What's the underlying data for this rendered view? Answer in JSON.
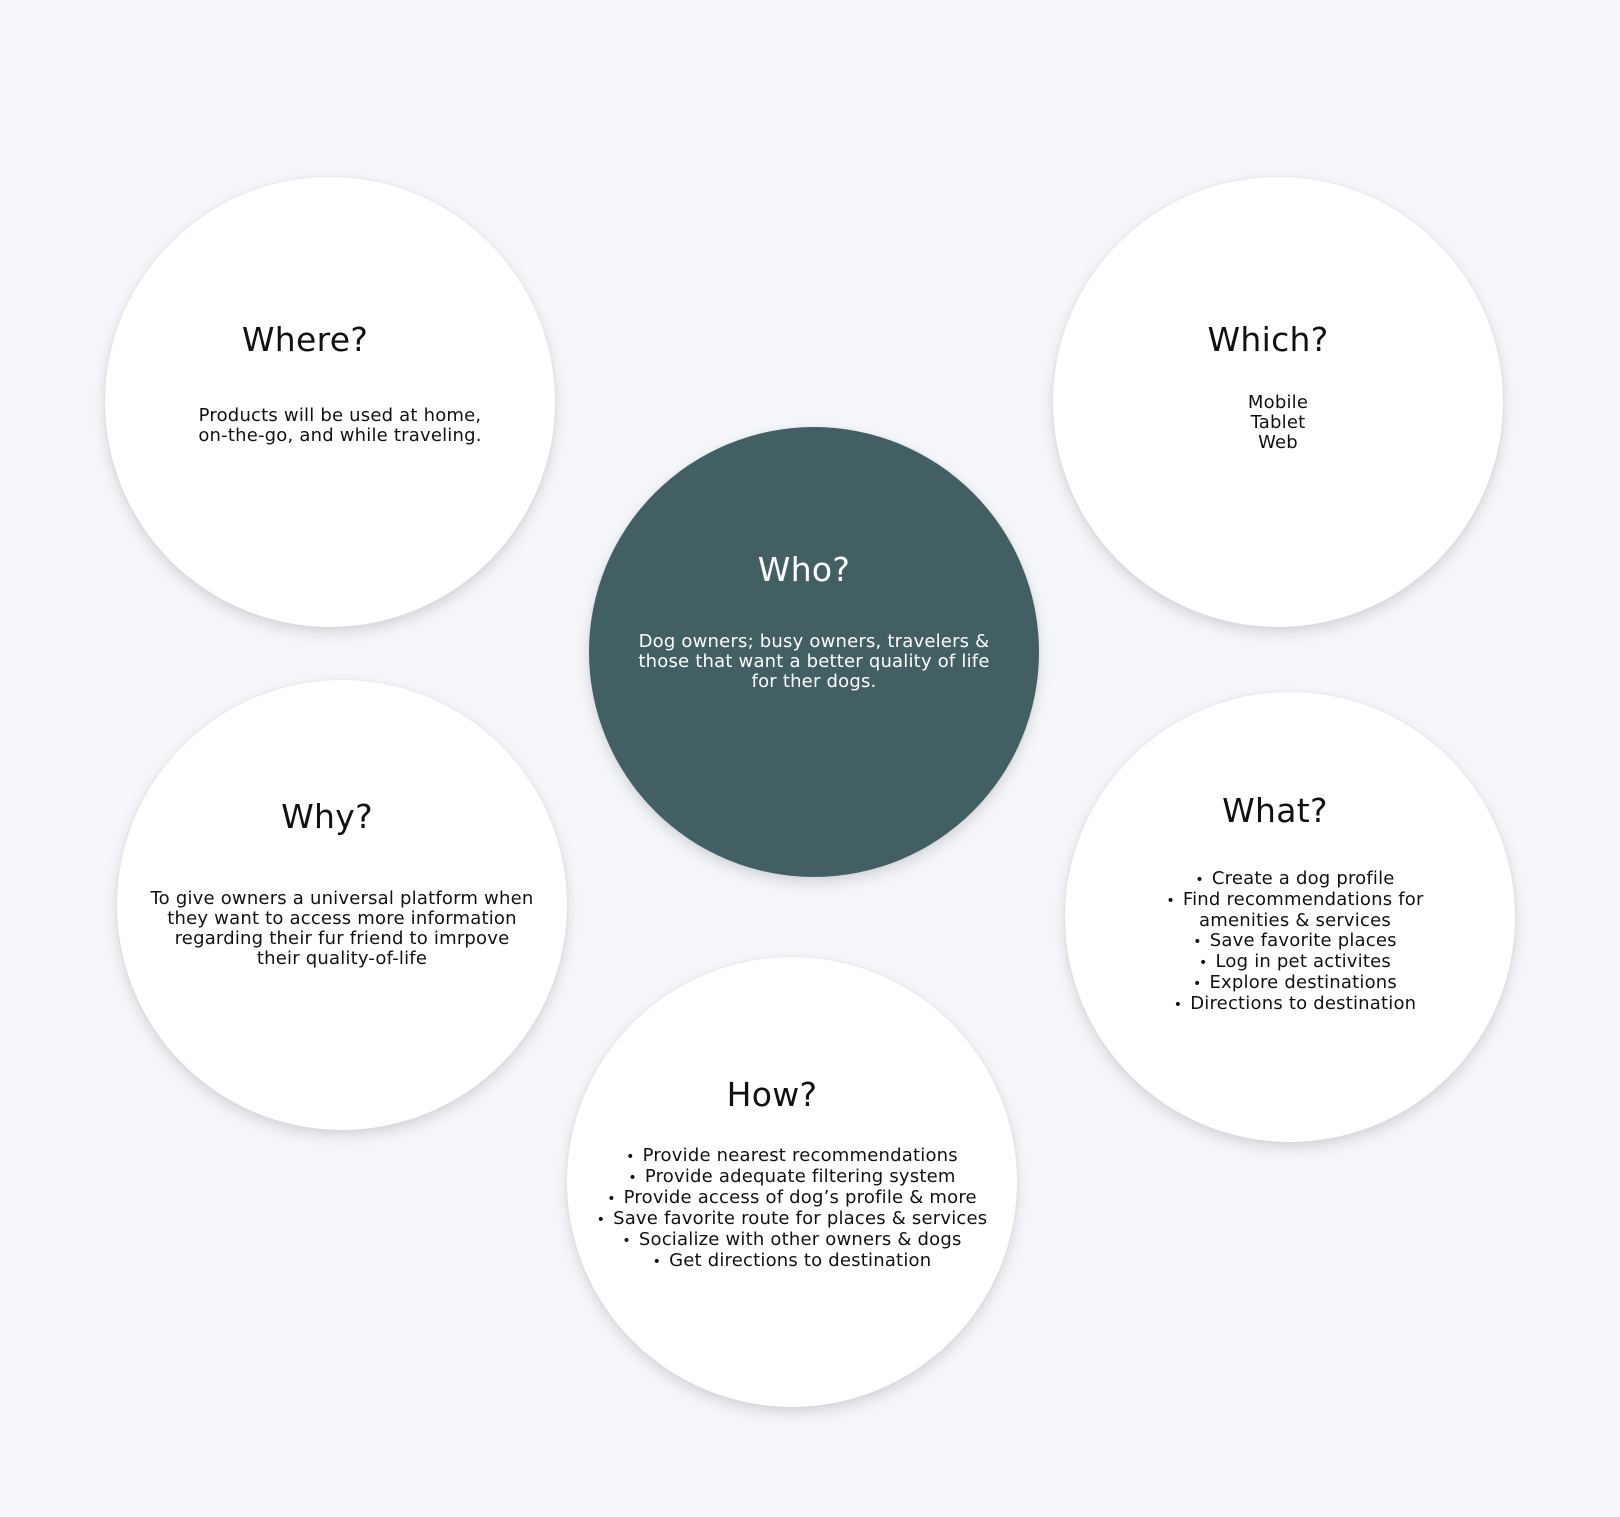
{
  "colors": {
    "background": "#f4f6fa",
    "bubble": "#ffffff",
    "accent": "#426064"
  },
  "where": {
    "title": "Where?",
    "lines": [
      "Products will be used at home,",
      "on-the-go, and while traveling."
    ]
  },
  "which": {
    "title": "Which?",
    "lines": [
      "Mobile",
      "Tablet",
      "Web"
    ]
  },
  "who": {
    "title": "Who?",
    "lines": [
      "Dog owners; busy owners, travelers &",
      "those that want a better quality of life",
      "for ther dogs."
    ]
  },
  "why": {
    "title": "Why?",
    "lines": [
      "To give owners a universal platform when",
      "they want to access more information",
      "regarding their fur friend to imrpove",
      "their quality-of-life"
    ]
  },
  "what": {
    "title": "What?",
    "items": [
      "Create a dog profile",
      "Find recommendations for amenities & services",
      "Save favorite places",
      "Log in pet activites",
      "Explore destinations",
      "Directions to destination"
    ]
  },
  "how": {
    "title": "How?",
    "items": [
      "Provide nearest recommendations",
      "Provide adequate filtering system",
      "Provide access of dog’s profile & more",
      "Save favorite route for places & services",
      "Socialize with other owners & dogs",
      "Get directions to destination"
    ]
  }
}
